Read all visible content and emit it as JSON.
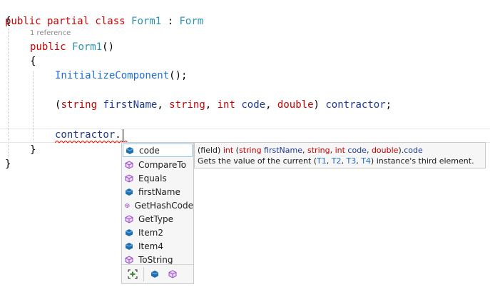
{
  "editor": {
    "class_decl": {
      "kw": "public partial class",
      "name": "Form1",
      "colon": " : ",
      "base": "Form"
    },
    "open_brace": "{",
    "ref_count": "1 reference",
    "ctor": {
      "kw": "public",
      "name": "Form1",
      "parens": "()"
    },
    "ctor_open": "{",
    "init_call": "InitializeComponent",
    "init_suffix": "();",
    "tuple_line": {
      "open": "(",
      "t1": "string",
      "n1": "firstName",
      "sep1": ", ",
      "t2": "string",
      "sep2": ", ",
      "t3": "int",
      "n3": "code",
      "sep3": ", ",
      "t4": "double",
      "close": ") ",
      "var": "contractor",
      "end": ";"
    },
    "member_access": {
      "var": "contractor",
      "dot": "."
    },
    "ctor_close": "}",
    "class_close": "}"
  },
  "completion": {
    "items": [
      {
        "label": "code",
        "icon": "field-icon",
        "selected": true
      },
      {
        "label": "CompareTo",
        "icon": "method-icon"
      },
      {
        "label": "Equals",
        "icon": "method-icon"
      },
      {
        "label": "firstName",
        "icon": "field-icon"
      },
      {
        "label": "GetHashCode",
        "icon": "method-icon"
      },
      {
        "label": "GetType",
        "icon": "method-icon"
      },
      {
        "label": "Item2",
        "icon": "field-icon"
      },
      {
        "label": "Item4",
        "icon": "field-icon"
      },
      {
        "label": "ToString",
        "icon": "method-icon"
      }
    ],
    "filters": [
      "expand-filter-icon",
      "field-filter-icon",
      "method-filter-icon"
    ]
  },
  "tooltip": {
    "line1": {
      "prefix": "(field) ",
      "t0": "int",
      "open": " (",
      "t1": "string",
      "n1": "firstName",
      "sep1": ", ",
      "t2": "string",
      "sep2": ", ",
      "t3": "int",
      "n3": "code",
      "sep3": ", ",
      "t4": "double",
      "close": ").",
      "member": "code"
    },
    "line2": {
      "pre": "Gets the value of the current (",
      "a": "T1",
      "s1": ", ",
      "b": "T2",
      "s2": ", ",
      "c": "T3",
      "s3": ", ",
      "d": "T4",
      "post": ") instance's third element."
    }
  },
  "colors": {
    "keyword": "#cc0000",
    "type": "#2b91af",
    "identifier": "#1f3a93",
    "field_icon": "#1f6fb0",
    "method_icon": "#9b4fc4"
  }
}
